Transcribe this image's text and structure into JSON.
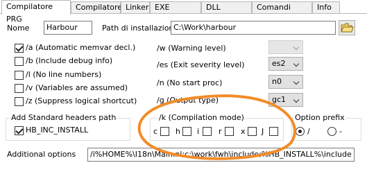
{
  "tabs": [
    "Compilatore PRG",
    "Compilatore C",
    "Linker",
    "EXE Defaults",
    "DLL Defaults",
    "Comandi utente",
    "Info"
  ],
  "nome_label": "Nome",
  "nome_value": "Harbour",
  "install_label": "Path di installazione",
  "install_value": "C:\\Work\\harbour",
  "checkboxes": [
    {
      "label": "/a (Automatic memvar decl.)",
      "checked": true
    },
    {
      "label": "/b (Include debug info)",
      "checked": false
    },
    {
      "label": "/l (No line numbers)",
      "checked": false
    },
    {
      "label": "/v (Variables are assumed)",
      "checked": false
    },
    {
      "label": "/z (Suppress logical shortcut)",
      "checked": false
    }
  ],
  "options": [
    {
      "label": "/w (Warning level)",
      "value": ""
    },
    {
      "label": "/es (Exit severity level)",
      "value": "es2"
    },
    {
      "label": "/n (No start proc)",
      "value": "n0"
    },
    {
      "label": "/g (Output type)",
      "value": "gc1"
    }
  ],
  "headers_group_label": "Add Standard headers path",
  "hb_inc_label": "HB_INC_INSTALL",
  "compile_mode_label": "/k (Compilation mode)",
  "compile_mode_items": [
    "c",
    "h",
    "i",
    "r",
    "x",
    "J"
  ],
  "option_prefix_label": "Option prefix",
  "prefix_options": [
    "/",
    "-"
  ],
  "additional_label": "Additional options",
  "additional_value": "/i%HOME%\\I18n\\Main.nl;c:\\work\\fwh\\include;%HB_INSTALL%\\include",
  "colors": {
    "annotation": "#f28c28"
  }
}
